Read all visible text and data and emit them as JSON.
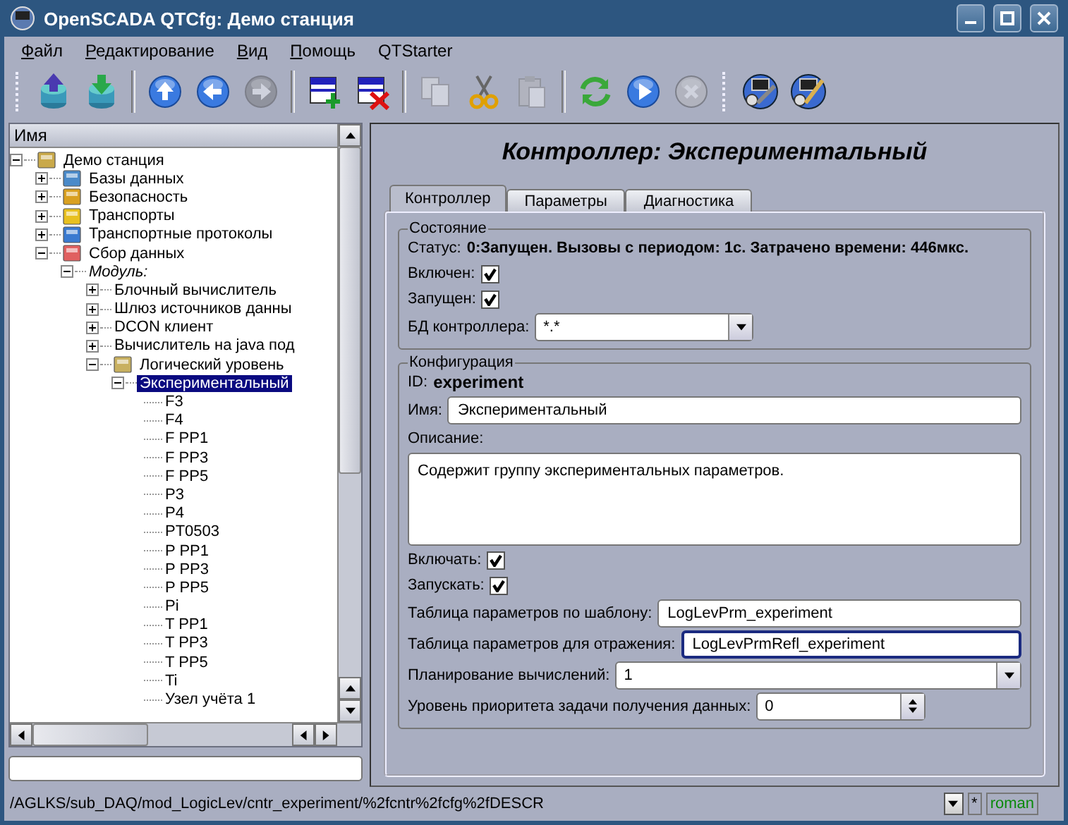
{
  "window": {
    "title": "OpenSCADA QTCfg: Демо станция"
  },
  "menu": [
    {
      "label": "Файл",
      "mnemonic": true
    },
    {
      "label": "Редактирование",
      "mnemonic": true
    },
    {
      "label": "Вид",
      "mnemonic": true
    },
    {
      "label": "Помощь",
      "mnemonic": true
    },
    {
      "label": "QTStarter",
      "mnemonic": false
    }
  ],
  "toolbar": [
    [
      {
        "disabled": false
      },
      {
        "disabled": false
      }
    ],
    [
      {
        "disabled": false
      },
      {
        "disabled": false
      },
      {
        "disabled": true
      }
    ],
    [
      {
        "disabled": false
      },
      {
        "disabled": false
      }
    ],
    [
      {
        "disabled": true
      },
      {
        "disabled": false
      },
      {
        "disabled": true
      }
    ],
    [
      {
        "disabled": false
      },
      {
        "disabled": false
      },
      {
        "disabled": true
      }
    ],
    [
      {
        "disabled": false
      },
      {
        "disabled": false
      }
    ]
  ],
  "tree": {
    "header": "Имя",
    "items": [
      {
        "label": "Демо станция",
        "expanded": true,
        "selected": false,
        "children": [
          {
            "label": "Базы данных",
            "expanded": false,
            "selected": false
          },
          {
            "label": "Безопасность",
            "expanded": false,
            "selected": false
          },
          {
            "label": "Транспорты",
            "expanded": false,
            "selected": false
          },
          {
            "label": "Транспортные протоколы",
            "expanded": false,
            "selected": false
          },
          {
            "label": "Сбор данных",
            "expanded": true,
            "selected": false,
            "children": [
              {
                "label": "Модуль:",
                "kind": "group",
                "expanded": true,
                "selected": false,
                "children": [
                  {
                    "label": "Блочный вычислитель",
                    "expanded": false,
                    "selected": false
                  },
                  {
                    "label": "Шлюз источников данны",
                    "expanded": false,
                    "selected": false
                  },
                  {
                    "label": "DCON клиент",
                    "expanded": false,
                    "selected": false
                  },
                  {
                    "label": "Вычислитель на java под",
                    "expanded": false,
                    "selected": false
                  },
                  {
                    "label": "Логический уровень",
                    "expanded": true,
                    "selected": false,
                    "children": [
                      {
                        "label": "Экспериментальный",
                        "expanded": true,
                        "selected": true,
                        "children": [
                          {
                            "label": "F3",
                            "selected": false
                          },
                          {
                            "label": "F4",
                            "selected": false
                          },
                          {
                            "label": "F PP1",
                            "selected": false
                          },
                          {
                            "label": "F PP3",
                            "selected": false
                          },
                          {
                            "label": "F PP5",
                            "selected": false
                          },
                          {
                            "label": "P3",
                            "selected": false
                          },
                          {
                            "label": "P4",
                            "selected": false
                          },
                          {
                            "label": "PT0503",
                            "selected": false
                          },
                          {
                            "label": "P PP1",
                            "selected": false
                          },
                          {
                            "label": "P PP3",
                            "selected": false
                          },
                          {
                            "label": "P PP5",
                            "selected": false
                          },
                          {
                            "label": "Pi",
                            "selected": false
                          },
                          {
                            "label": "T PP1",
                            "selected": false
                          },
                          {
                            "label": "T PP3",
                            "selected": false
                          },
                          {
                            "label": "T PP5",
                            "selected": false
                          },
                          {
                            "label": "Ti",
                            "selected": false
                          },
                          {
                            "label": "Узел учёта 1",
                            "selected": false
                          }
                        ]
                      }
                    ]
                  }
                ]
              }
            ]
          }
        ]
      }
    ]
  },
  "page": {
    "title": "Контроллер: Экспериментальный",
    "tabs": [
      {
        "label": "Контроллер",
        "selected": true
      },
      {
        "label": "Параметры",
        "selected": false
      },
      {
        "label": "Диагностика",
        "selected": false
      }
    ],
    "state": {
      "legend": "Состояние",
      "status_label": "Статус:",
      "status": "0:Запущен. Вызовы с периодом: 1с. Затрачено времени: 446мкс.",
      "checks": [
        {
          "label": "Включен:",
          "checked": true
        },
        {
          "label": "Запущен:",
          "checked": true
        }
      ],
      "db": {
        "label": "БД контроллера:",
        "value": "*.*"
      }
    },
    "config": {
      "legend": "Конфигурация",
      "id_label": "ID:",
      "id": "experiment",
      "name": {
        "label": "Имя:",
        "value": "Экспериментальный"
      },
      "description": {
        "label": "Описание:",
        "value": "Содержит группу экспериментальных параметров."
      },
      "checks": [
        {
          "label": "Включать:",
          "checked": true
        },
        {
          "label": "Запускать:",
          "checked": true
        }
      ],
      "fields": [
        {
          "kind": "text",
          "label": "Таблица параметров по шаблону:",
          "value": "LogLevPrm_experiment"
        },
        {
          "kind": "text",
          "label": "Таблица параметров для отражения:",
          "value": "LogLevPrmRefl_experiment",
          "focused": true
        },
        {
          "kind": "combo",
          "label": "Планирование вычислений:",
          "value": "1"
        },
        {
          "kind": "spin",
          "label": "Уровень приоритета задачи получения данных:",
          "value": "0"
        }
      ]
    }
  },
  "status_bar": {
    "path": "/AGLKS/sub_DAQ/mod_LogicLev/cntr_experiment/%2fcntr%2fcfg%2fDESCR",
    "modified": "*",
    "user": "roman"
  }
}
